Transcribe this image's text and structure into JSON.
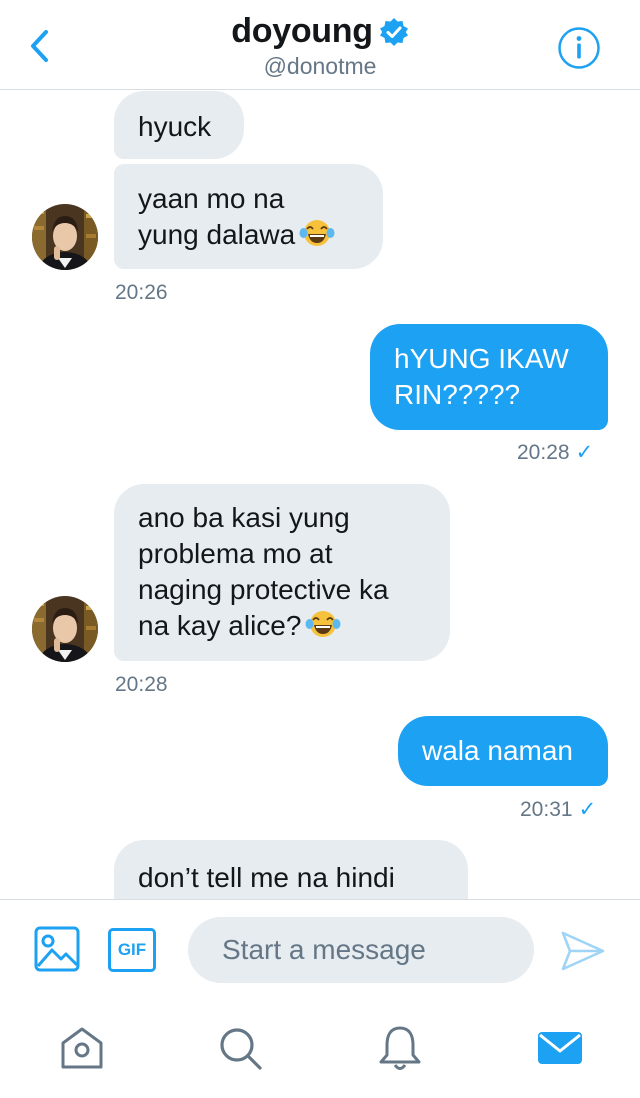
{
  "header": {
    "title": "doyoung",
    "handle": "@donotme",
    "icons": {
      "back": "chevron-left-icon",
      "verified": "verified-badge-icon",
      "info": "info-icon"
    }
  },
  "messages": [
    {
      "direction": "incoming",
      "text_lines": [
        "hyuck"
      ]
    },
    {
      "direction": "incoming",
      "text_lines": [
        "yaan mo na",
        "yung dalawa"
      ],
      "emoji": "face-with-tears-of-joy"
    },
    {
      "direction": "incoming",
      "time": "20:26"
    },
    {
      "direction": "outgoing",
      "text_lines": [
        "hYUNG IKAW",
        "RIN?????"
      ],
      "time": "20:28",
      "check": "✓"
    },
    {
      "direction": "incoming",
      "text_lines": [
        "ano ba kasi yung",
        "problema mo at",
        "naging protective ka",
        "na kay alice?"
      ],
      "emoji": "face-with-tears-of-joy",
      "time": "20:28"
    },
    {
      "direction": "outgoing",
      "text_lines": [
        "wala naman"
      ],
      "time": "20:31",
      "check": "✓"
    },
    {
      "direction": "incoming",
      "text_lines": [
        "don’t tell me na hindi"
      ]
    }
  ],
  "composer": {
    "placeholder": "Start a message",
    "gif_label": "GIF",
    "icons": {
      "media": "image-icon",
      "send": "send-icon"
    }
  },
  "tabbar": {
    "items": [
      "home-icon",
      "search-icon",
      "notifications-icon",
      "messages-icon"
    ],
    "active": "messages-icon"
  },
  "colors": {
    "accent": "#1da1f2",
    "bubble_in": "#e6ecf0",
    "text": "#14171a",
    "muted": "#657786"
  }
}
